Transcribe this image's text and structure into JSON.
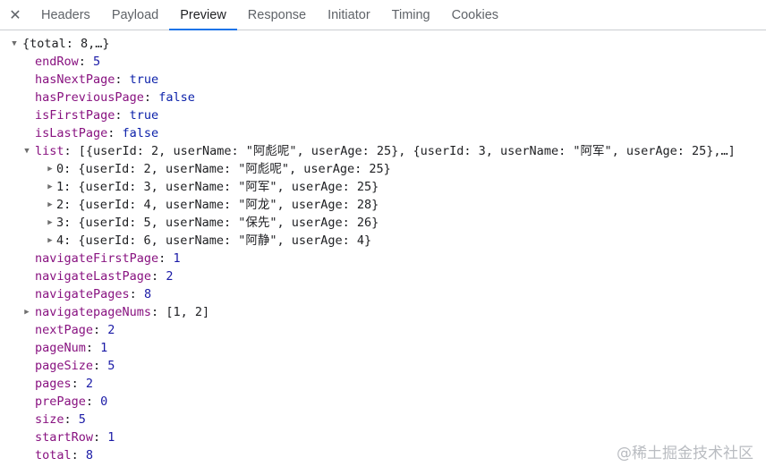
{
  "tabs": {
    "close_glyph": "✕",
    "items": [
      "Headers",
      "Payload",
      "Preview",
      "Response",
      "Initiator",
      "Timing",
      "Cookies"
    ],
    "active": "Preview"
  },
  "tree": {
    "root": {
      "arrow": "▼",
      "text": "{total: 8,…}"
    },
    "rows": [
      {
        "key": "endRow",
        "value": "5",
        "type": "num"
      },
      {
        "key": "hasNextPage",
        "value": "true",
        "type": "bool"
      },
      {
        "key": "hasPreviousPage",
        "value": "false",
        "type": "bool"
      },
      {
        "key": "isFirstPage",
        "value": "true",
        "type": "bool"
      },
      {
        "key": "isLastPage",
        "value": "false",
        "type": "bool"
      },
      {
        "key": "list",
        "value": "[{userId: 2, userName: \"阿彪呢\", userAge: 25}, {userId: 3, userName: \"阿军\", userAge: 25},…]",
        "type": "preview",
        "arrow": "▼"
      },
      {
        "key": "0",
        "value": "{userId: 2, userName: \"阿彪呢\", userAge: 25}",
        "type": "preview",
        "arrow": "▶",
        "child": true
      },
      {
        "key": "1",
        "value": "{userId: 3, userName: \"阿军\", userAge: 25}",
        "type": "preview",
        "arrow": "▶",
        "child": true
      },
      {
        "key": "2",
        "value": "{userId: 4, userName: \"阿龙\", userAge: 28}",
        "type": "preview",
        "arrow": "▶",
        "child": true
      },
      {
        "key": "3",
        "value": "{userId: 5, userName: \"保先\", userAge: 26}",
        "type": "preview",
        "arrow": "▶",
        "child": true
      },
      {
        "key": "4",
        "value": "{userId: 6, userName: \"阿静\", userAge: 4}",
        "type": "preview",
        "arrow": "▶",
        "child": true
      },
      {
        "key": "navigateFirstPage",
        "value": "1",
        "type": "num"
      },
      {
        "key": "navigateLastPage",
        "value": "2",
        "type": "num"
      },
      {
        "key": "navigatePages",
        "value": "8",
        "type": "num"
      },
      {
        "key": "navigatepageNums",
        "value": "[1, 2]",
        "type": "preview",
        "arrow": "▶"
      },
      {
        "key": "nextPage",
        "value": "2",
        "type": "num"
      },
      {
        "key": "pageNum",
        "value": "1",
        "type": "num"
      },
      {
        "key": "pageSize",
        "value": "5",
        "type": "num"
      },
      {
        "key": "pages",
        "value": "2",
        "type": "num"
      },
      {
        "key": "prePage",
        "value": "0",
        "type": "num"
      },
      {
        "key": "size",
        "value": "5",
        "type": "num"
      },
      {
        "key": "startRow",
        "value": "1",
        "type": "num"
      },
      {
        "key": "total",
        "value": "8",
        "type": "num"
      }
    ]
  },
  "watermark": "@稀土掘金技术社区",
  "colors": {
    "key": "#881280",
    "number": "#1a1aa6",
    "boolean": "#0d22aa",
    "active_tab_underline": "#1a73e8"
  }
}
